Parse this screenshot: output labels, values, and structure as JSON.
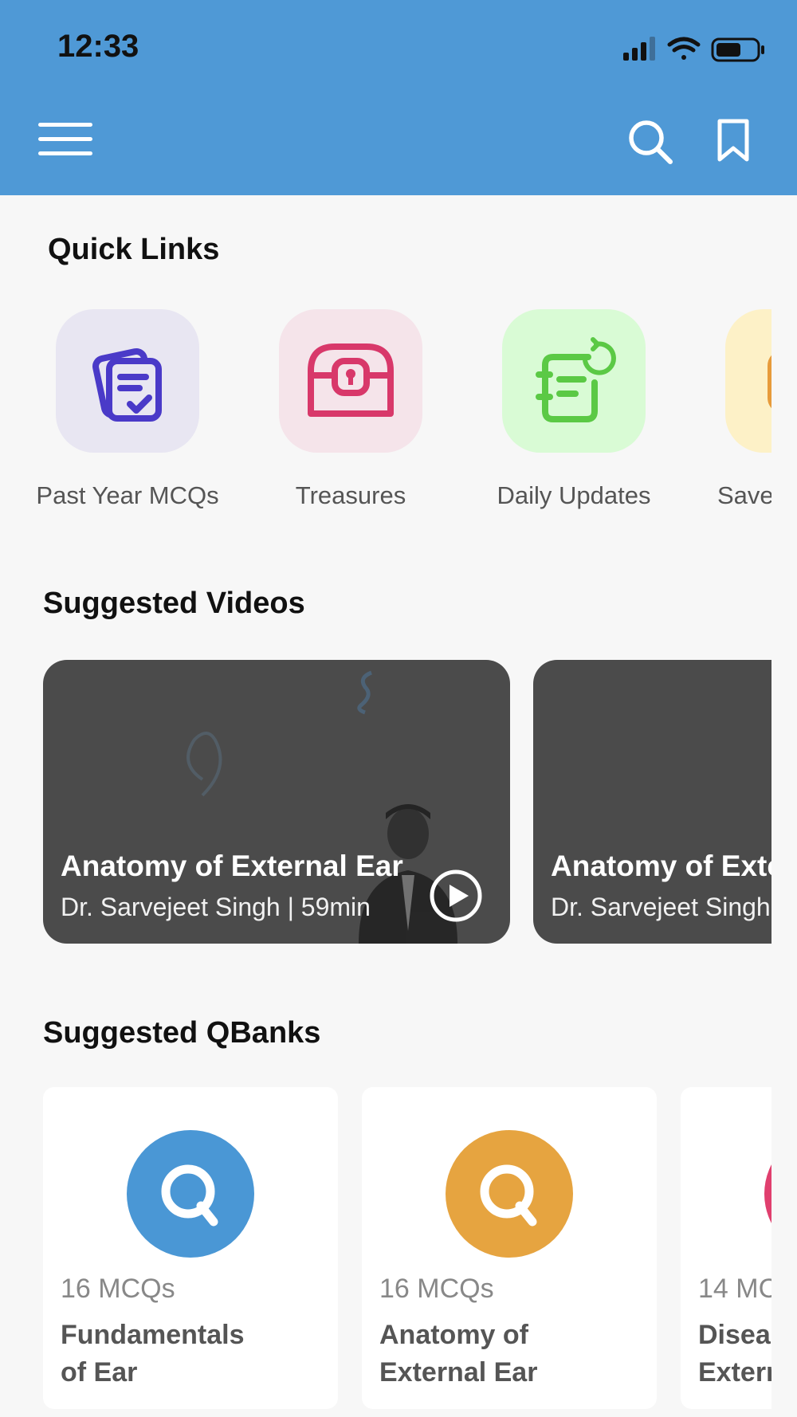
{
  "status_bar": {
    "time": "12:33",
    "icons": [
      "signal-icon",
      "wifi-icon",
      "battery-icon"
    ]
  },
  "header": {
    "background": "#4f99d6",
    "icons": {
      "menu": "hamburger-menu-icon",
      "search": "search-icon",
      "bookmark": "bookmark-icon"
    }
  },
  "quick_links": {
    "title": "Quick Links",
    "items": [
      {
        "label": "Past Year MCQs",
        "icon": "clipboard-check-icon",
        "bg": "#e8e6f2",
        "fg": "#4a3ac8"
      },
      {
        "label": "Treasures",
        "icon": "treasure-chest-icon",
        "bg": "#f5e4ea",
        "fg": "#d8386a"
      },
      {
        "label": "Daily Updates",
        "icon": "notebook-refresh-icon",
        "bg": "#d9fbd5",
        "fg": "#5bc945"
      },
      {
        "label": "Save",
        "icon": "saved-icon",
        "bg": "#fdf1c7",
        "fg": "#e79b3b"
      }
    ]
  },
  "suggested_videos": {
    "title": "Suggested Videos",
    "items": [
      {
        "title": "Anatomy of External Ear",
        "meta": "Dr. Sarvejeet Singh | 59min"
      },
      {
        "title": "Anatomy of Exte",
        "meta": "Dr. Sarvejeet Singh"
      }
    ]
  },
  "suggested_qbanks": {
    "title": "Suggested QBanks",
    "items": [
      {
        "count": "16 MCQs",
        "title": "Fundamentals\nof Ear",
        "color": "#4a97d5"
      },
      {
        "count": "16 MCQs",
        "title": "Anatomy of\nExternal Ear",
        "color": "#e6a440"
      },
      {
        "count": "14 MC",
        "title": "Disea\nExtern",
        "color": "#e03f6e"
      }
    ]
  }
}
